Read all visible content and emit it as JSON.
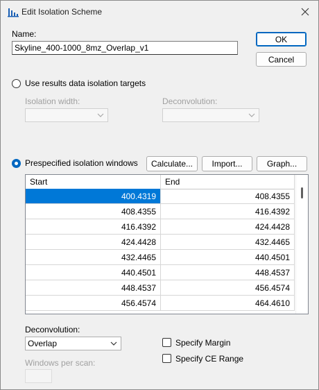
{
  "window": {
    "title": "Edit Isolation Scheme"
  },
  "name": {
    "label": "Name:",
    "value": "Skyline_400-1000_8mz_Overlap_v1"
  },
  "buttons": {
    "ok": "OK",
    "cancel": "Cancel",
    "calculate": "Calculate...",
    "import": "Import...",
    "graph": "Graph..."
  },
  "results_option": {
    "label": "Use results data isolation targets",
    "selected": false
  },
  "isolation_width": {
    "label": "Isolation width:",
    "value": ""
  },
  "deconvolution_top": {
    "label": "Deconvolution:",
    "value": ""
  },
  "prespecified_option": {
    "label": "Prespecified isolation windows",
    "selected": true
  },
  "grid": {
    "columns": [
      "Start",
      "End"
    ],
    "rows": [
      [
        "400.4319",
        "408.4355"
      ],
      [
        "408.4355",
        "416.4392"
      ],
      [
        "416.4392",
        "424.4428"
      ],
      [
        "424.4428",
        "432.4465"
      ],
      [
        "432.4465",
        "440.4501"
      ],
      [
        "440.4501",
        "448.4537"
      ],
      [
        "448.4537",
        "456.4574"
      ],
      [
        "456.4574",
        "464.4610"
      ]
    ],
    "selected_row": 0
  },
  "deconvolution": {
    "label": "Deconvolution:",
    "value": "Overlap"
  },
  "specify_margin": {
    "label": "Specify Margin",
    "checked": false
  },
  "specify_ce_range": {
    "label": "Specify CE Range",
    "checked": false
  },
  "windows_per_scan": {
    "label": "Windows per scan:",
    "value": ""
  },
  "colors": {
    "accent": "#0067c0",
    "selection": "#0078d7"
  }
}
